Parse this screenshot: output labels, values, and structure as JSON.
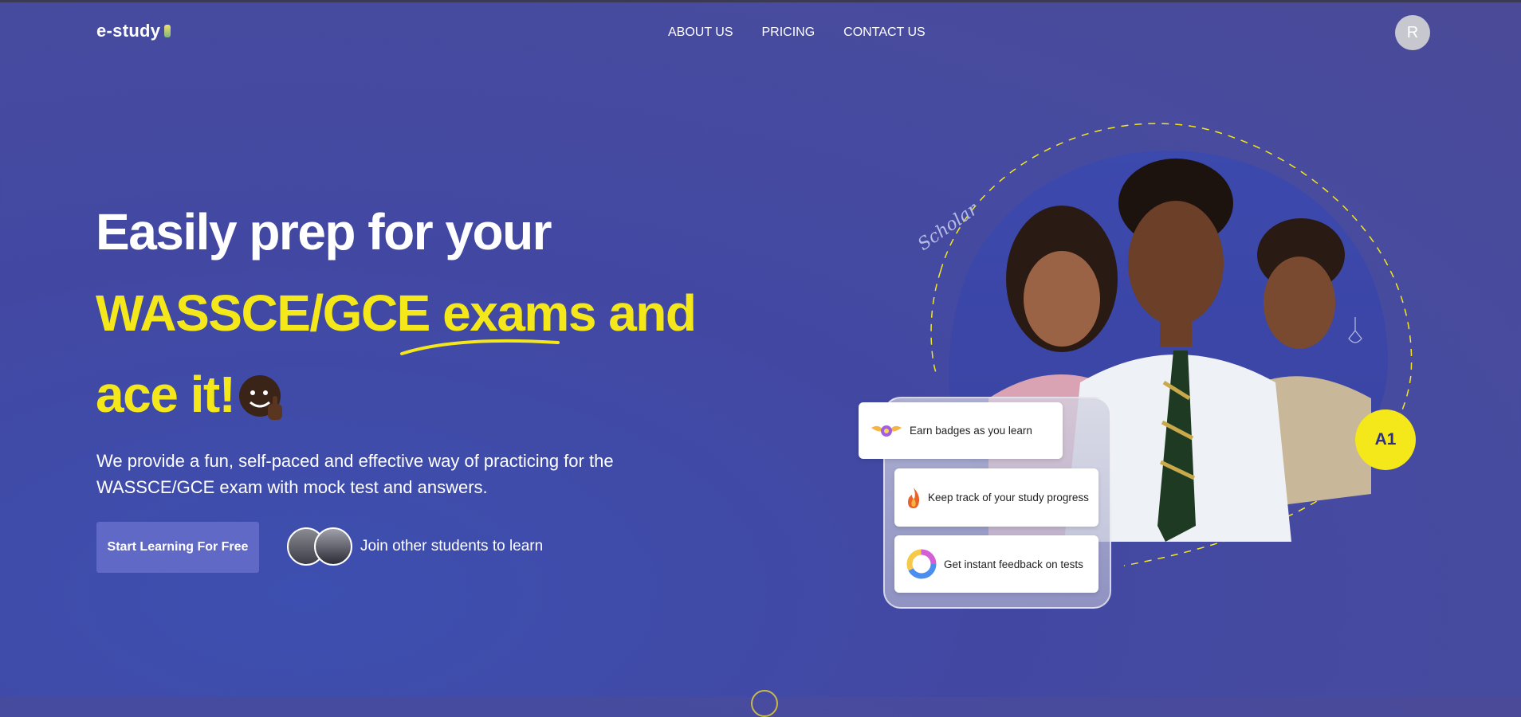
{
  "brand": {
    "logo_text": "e-study"
  },
  "nav": {
    "items": [
      "ABOUT US",
      "PRICING",
      "CONTACT US"
    ]
  },
  "user": {
    "avatar_initial": "R"
  },
  "hero": {
    "line1": "Easily prep for your",
    "line2": "WASSCE/GCE exams and",
    "line3": "ace it!",
    "description": "We provide a fun, self-paced and effective way of practicing for the WASSCE/GCE exam with mock test and answers.",
    "cta_label": "Start Learning For Free",
    "join_text": "Join other students to learn"
  },
  "features": [
    "Earn badges as you learn",
    "Keep track of your study progress",
    "Get instant feedback on tests"
  ],
  "art": {
    "scholar_text": "Scholar",
    "grade_badge": "A1"
  },
  "colors": {
    "accent_yellow": "#f4e81b",
    "cta_bg": "#6169c6",
    "background": "#4248a2"
  }
}
